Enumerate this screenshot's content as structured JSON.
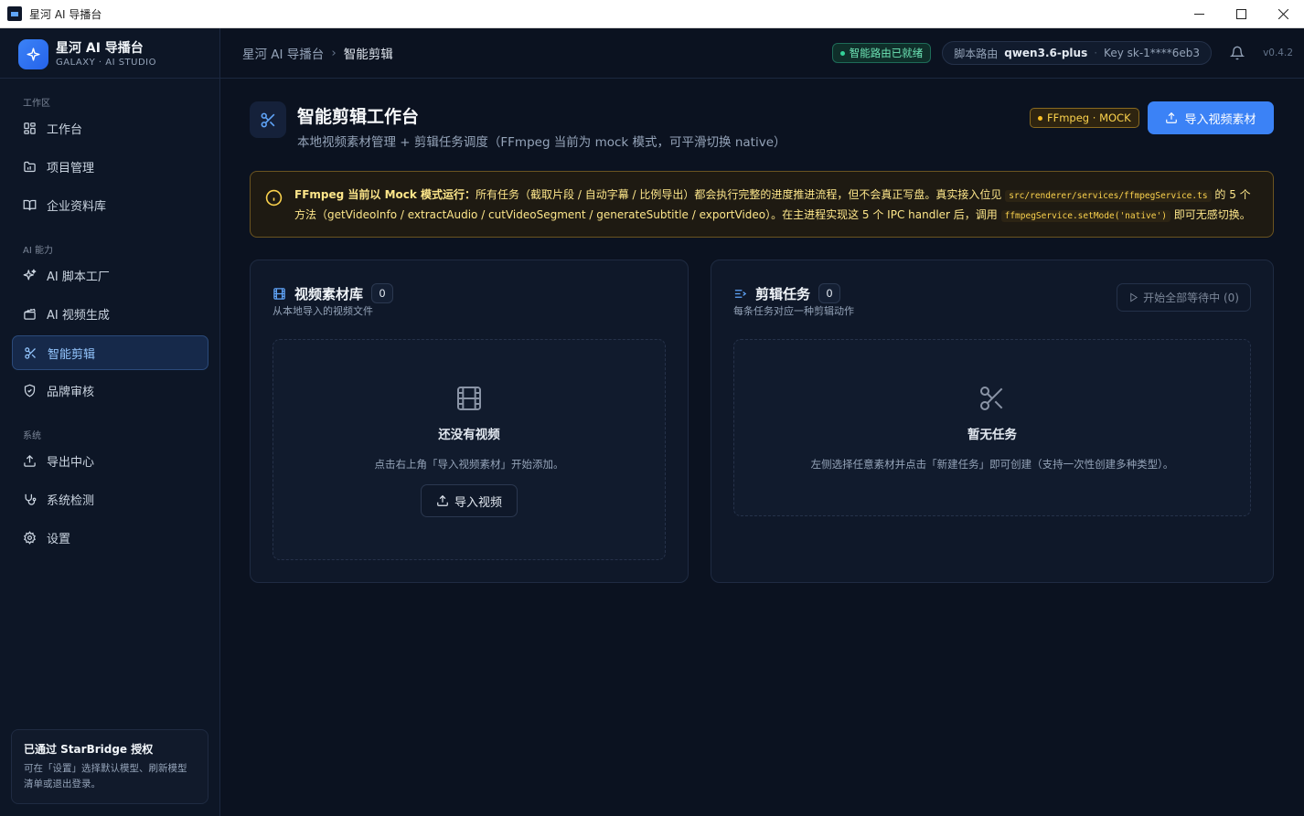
{
  "window": {
    "title": "星河 AI 导播台",
    "controls": [
      "minimize-icon",
      "maximize-icon",
      "close-icon"
    ]
  },
  "brand": {
    "name": "星河 AI 导播台",
    "subtitle": "GALAXY · AI STUDIO"
  },
  "sidebar": {
    "sections": [
      {
        "label": "工作区",
        "items": [
          {
            "label": "工作台",
            "icon": "dashboard-icon"
          },
          {
            "label": "项目管理",
            "icon": "folder-icon"
          },
          {
            "label": "企业资料库",
            "icon": "book-icon"
          }
        ]
      },
      {
        "label": "AI 能力",
        "items": [
          {
            "label": "AI 脚本工厂",
            "icon": "sparkles-icon"
          },
          {
            "label": "AI 视频生成",
            "icon": "clapperboard-icon"
          },
          {
            "label": "智能剪辑",
            "icon": "scissors-icon",
            "active": true
          },
          {
            "label": "品牌审核",
            "icon": "shield-icon"
          }
        ]
      },
      {
        "label": "系统",
        "items": [
          {
            "label": "导出中心",
            "icon": "upload-icon"
          },
          {
            "label": "系统检测",
            "icon": "stethoscope-icon"
          },
          {
            "label": "设置",
            "icon": "gear-icon"
          }
        ]
      }
    ],
    "auth": {
      "title": "已通过 StarBridge 授权",
      "desc": "可在「设置」选择默认模型、刷新模型清单或退出登录。"
    }
  },
  "topbar": {
    "breadcrumb_root": "星河 AI 导播台",
    "breadcrumb_current": "智能剪辑",
    "status": "智能路由已就绪",
    "route_label": "脚本路由",
    "route_model": "qwen3.6-plus",
    "route_key": "Key sk-1****6eb3",
    "version": "v0.4.2"
  },
  "page": {
    "title": "智能剪辑工作台",
    "subtitle": "本地视频素材管理 + 剪辑任务调度（FFmpeg 当前为 mock 模式，可平滑切换 native）",
    "mode_badge": "FFmpeg · MOCK",
    "import_button": "导入视频素材"
  },
  "notice": {
    "bold_lead": "FFmpeg 当前以 Mock 模式运行：",
    "text1": "所有任务（截取片段 / 自动字幕 / 比例导出）都会执行完整的进度推进流程，但不会真正写盘。真实接入位见",
    "code1": "src/renderer/services/ffmpegService.ts",
    "text2": "的 5 个方法（getVideoInfo / extractAudio / cutVideoSegment / generateSubtitle / exportVideo）。在主进程实现这 5 个 IPC handler 后，调用",
    "code2": "ffmpegService.setMode('native')",
    "text3": "即可无感切换。"
  },
  "library": {
    "title": "视频素材库",
    "count": "0",
    "desc": "从本地导入的视频文件",
    "empty_title": "还没有视频",
    "empty_desc": "点击右上角「导入视频素材」开始添加。",
    "import_button": "导入视频"
  },
  "tasks": {
    "title": "剪辑任务",
    "count": "0",
    "desc": "每条任务对应一种剪辑动作",
    "start_button": "开始全部等待中 (0)",
    "empty_title": "暂无任务",
    "empty_desc": "左侧选择任意素材并点击「新建任务」即可创建（支持一次性创建多种类型）。"
  },
  "colors": {
    "accent": "#3b82f6",
    "background": "#0b1220",
    "warning": "#fcd34d",
    "success": "#34d399"
  }
}
